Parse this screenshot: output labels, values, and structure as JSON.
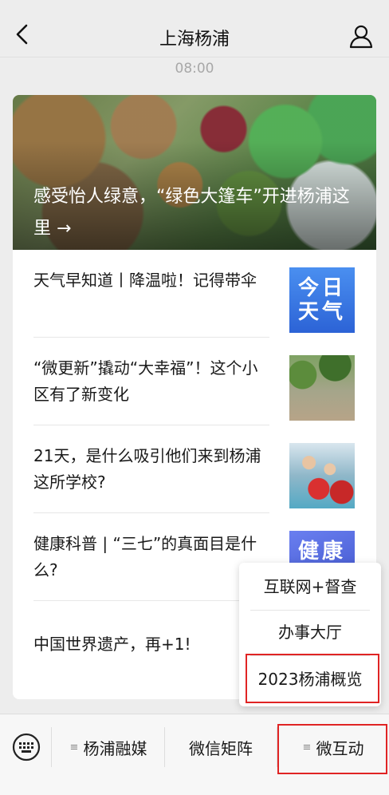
{
  "header": {
    "title": "上海杨浦",
    "back_icon": "chevron-left-icon",
    "profile_icon": "person-icon"
  },
  "timestamp": "08:00",
  "hero": {
    "title": "感受怡人绿意，“绿色大篷车”开进杨浦这里 →"
  },
  "articles": [
    {
      "title": "天气早知道丨降温啦！记得带伞",
      "thumb_text": "今日\n天气"
    },
    {
      "title": "“微更新”撬动“大幸福”！这个小区有了新变化"
    },
    {
      "title": "21天，是什么吸引他们来到杨浦这所学校?"
    },
    {
      "title": "健康科普 | “三七”的真面目是什么?",
      "thumb_text": "健康\n科普"
    },
    {
      "title": "中国世界遗产，再+1!"
    }
  ],
  "popup_menu": {
    "items": [
      "互联网+督查",
      "办事大厅",
      "2023杨浦概览"
    ]
  },
  "bottom_menu": {
    "keyboard_icon": "keyboard-icon",
    "tabs": [
      "杨浦融媒",
      "微信矩阵",
      "微互动"
    ],
    "menu_glyph": "≡"
  },
  "colors": {
    "background": "#ededed",
    "highlight": "#e02424",
    "weather_thumb": "#3a78e6",
    "health_thumb": "#5567dd"
  }
}
